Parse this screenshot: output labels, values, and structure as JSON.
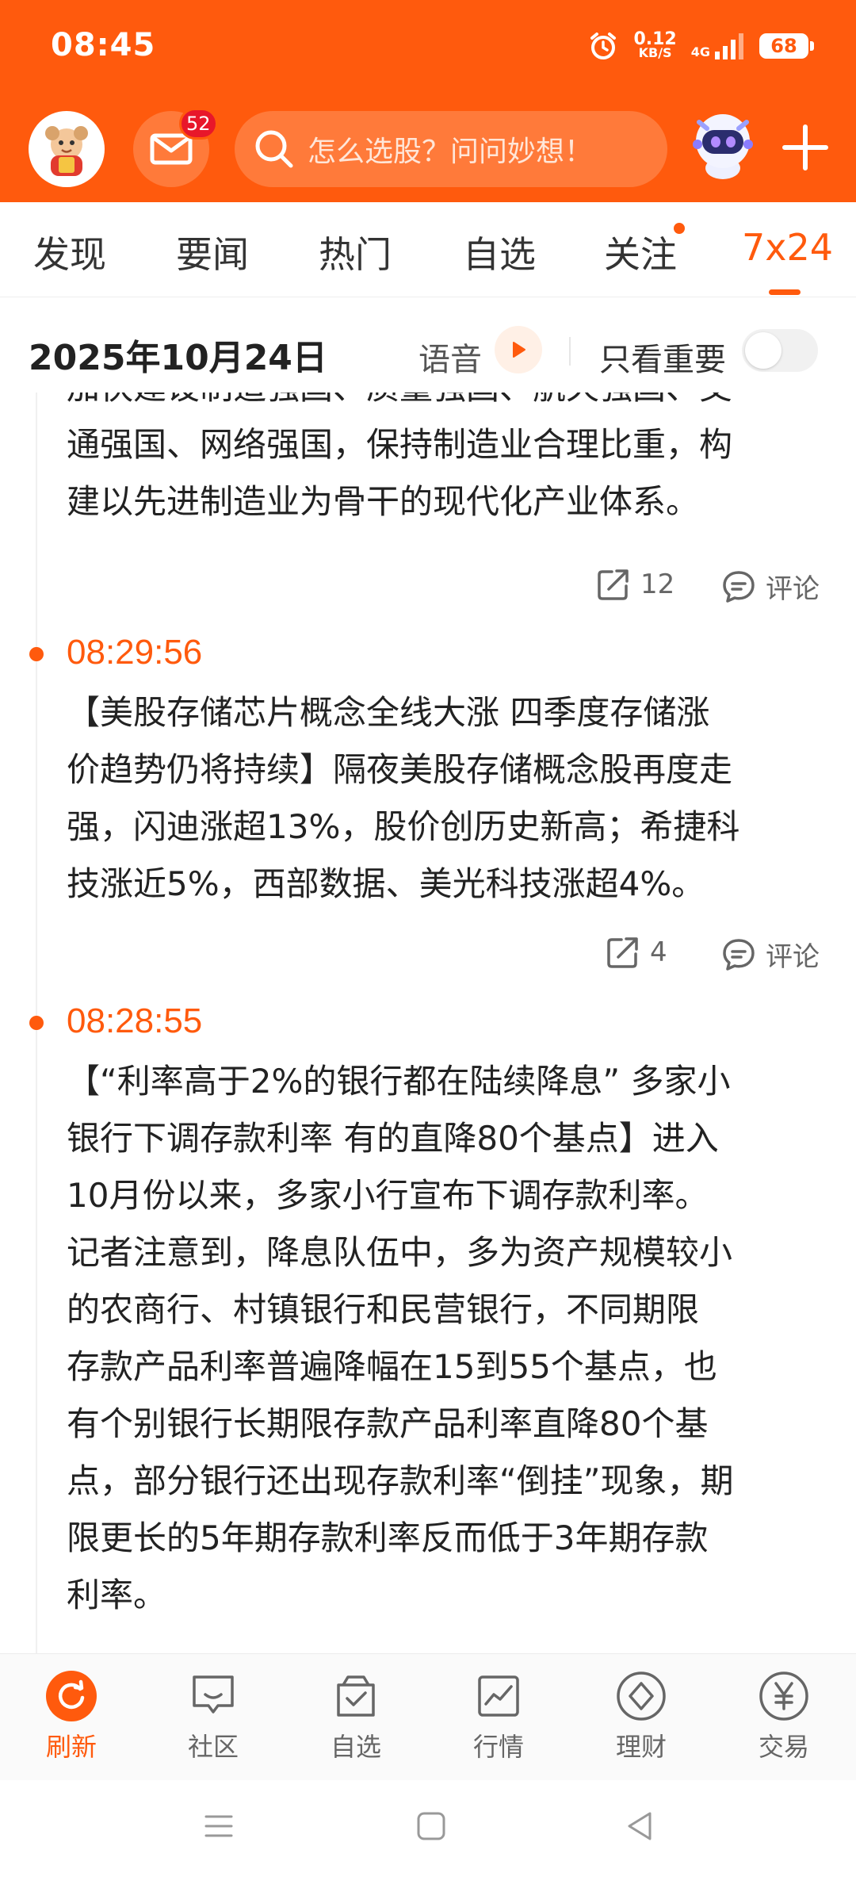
{
  "status_bar": {
    "time": "08:45",
    "net_speed_value": "0.12",
    "net_speed_unit": "KB/S",
    "network": "4G",
    "battery": "68"
  },
  "header": {
    "mail_badge": "52",
    "search_placeholder": "怎么选股？问问妙想！",
    "accent_color": "#ff5a0d"
  },
  "tabs": [
    {
      "label": "发现"
    },
    {
      "label": "要闻"
    },
    {
      "label": "热门"
    },
    {
      "label": "自选"
    },
    {
      "label": "关注"
    },
    {
      "label": "7x24"
    }
  ],
  "datebar": {
    "date": "2025年10月24日",
    "voice_label": "语音",
    "important_label": "只看重要"
  },
  "feed": {
    "partial_item": {
      "lines": [
        "加快建设制造强国、质量强国、航天强国、交",
        "通强国、网络强国，保持制造业合理比重，构",
        "建以先进制造业为骨干的现代化产业体系。"
      ],
      "share_count": "12",
      "comment_label": "评论"
    },
    "items": [
      {
        "time": "08:29:56",
        "lines": [
          "【美股存储芯片概念全线大涨 四季度存储涨",
          "价趋势仍将持续】隔夜美股存储概念股再度走",
          "强，闪迪涨超13%，股价创历史新高；希捷科",
          "技涨近5%，西部数据、美光科技涨超4%。"
        ],
        "share_count": "4",
        "comment_label": "评论"
      },
      {
        "time": "08:28:55",
        "lines": [
          "【“利率高于2%的银行都在陆续降息” 多家小",
          "银行下调存款利率 有的直降80个基点】进入",
          "10月份以来，多家小行宣布下调存款利率。",
          "记者注意到，降息队伍中，多为资产规模较小",
          "的农商行、村镇银行和民营银行，不同期限",
          "存款产品利率普遍降幅在15到55个基点，也",
          "有个别银行长期限存款产品利率直降80个基",
          "点，部分银行还出现存款利率“倒挂”现象，期",
          "限更长的5年期存款利率反而低于3年期存款",
          "利率。"
        ]
      }
    ]
  },
  "bottom_nav": [
    {
      "label": "刷新",
      "icon": "refresh-icon"
    },
    {
      "label": "社区",
      "icon": "chat-icon"
    },
    {
      "label": "自选",
      "icon": "favorite-check-icon"
    },
    {
      "label": "行情",
      "icon": "market-chart-icon"
    },
    {
      "label": "理财",
      "icon": "wealth-diamond-icon"
    },
    {
      "label": "交易",
      "icon": "yen-icon"
    }
  ]
}
